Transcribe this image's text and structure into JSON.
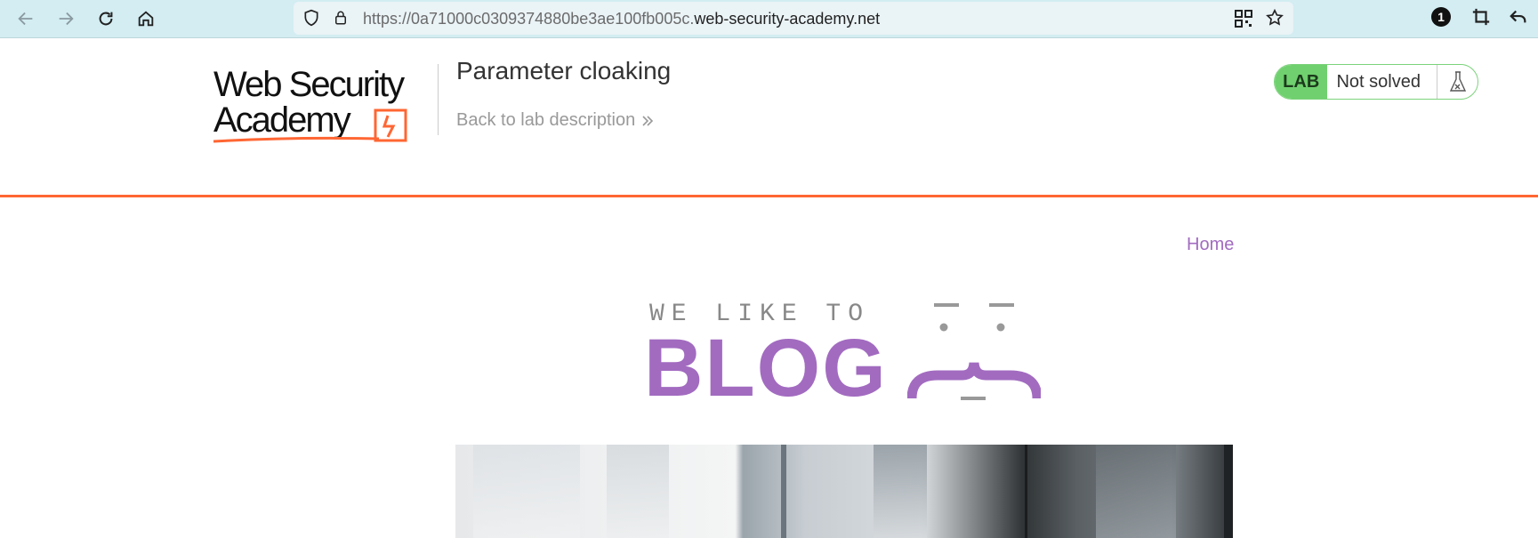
{
  "browser": {
    "url_prefix": "https://0a71000c0309374880be3ae100fb005c.",
    "url_domain": "web-security-academy.net",
    "extension_badge": "1"
  },
  "lab": {
    "logo_line1": "Web Security",
    "logo_line2": "Academy",
    "title": "Parameter cloaking",
    "back_link": "Back to lab description",
    "badge": "LAB",
    "status": "Not solved"
  },
  "blog": {
    "nav_home": "Home",
    "tagline": "WE LIKE TO",
    "word": "BLOG"
  },
  "colors": {
    "accent_orange": "#ff6633",
    "lab_green": "#70d06f",
    "blog_purple": "#a26bc0"
  }
}
